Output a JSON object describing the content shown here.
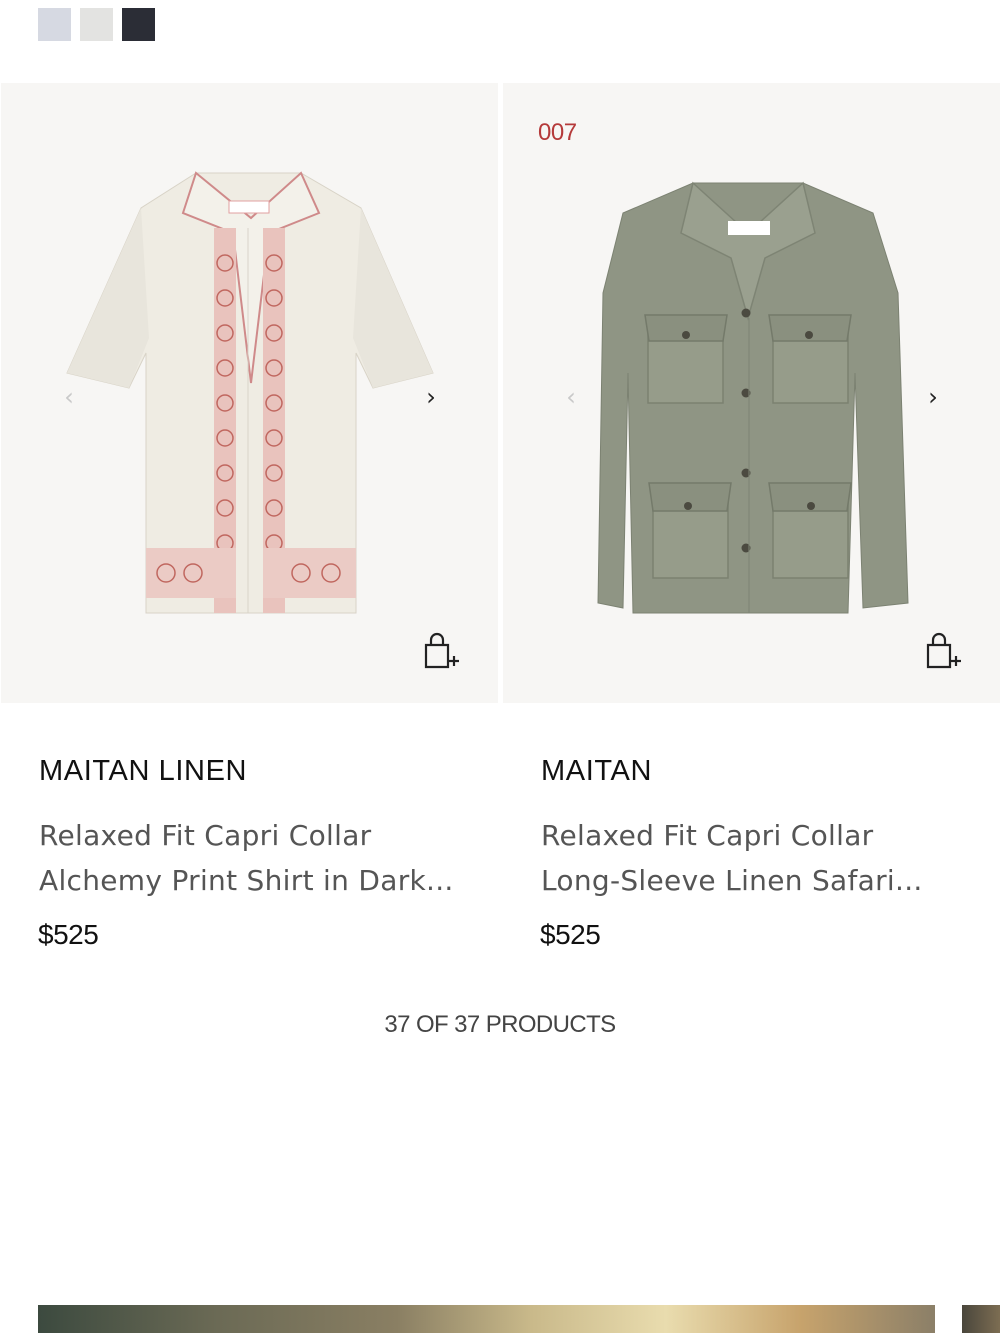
{
  "swatches": [
    {
      "name": "light-blue",
      "color": "#d6d9e2"
    },
    {
      "name": "light-grey",
      "color": "#e3e3e1"
    },
    {
      "name": "navy",
      "color": "#2b2d36"
    }
  ],
  "products": [
    {
      "badge": "",
      "brand": "MAITAN LINEN",
      "desc_line1": "Relaxed Fit Capri Collar",
      "desc_line2": "Alchemy Print Shirt in Dark...",
      "price": "$525",
      "image": "white-linen-shirt-red-print"
    },
    {
      "badge": "007",
      "brand": "MAITAN",
      "desc_line1": "Relaxed Fit Capri Collar",
      "desc_line2": "Long-Sleeve Linen Safari...",
      "price": "$525",
      "image": "olive-linen-safari-jacket"
    }
  ],
  "icons": {
    "prev": "‹",
    "next": "›"
  },
  "count_text": "37 OF 37 PRODUCTS"
}
